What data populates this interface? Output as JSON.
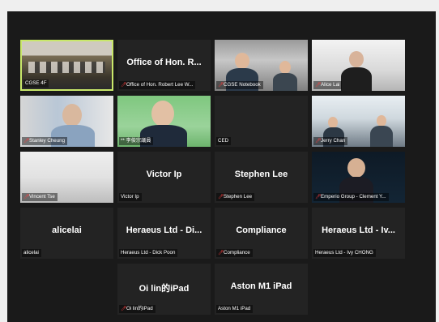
{
  "tiles": [
    {
      "label": "CGSE 4F",
      "center_name": "",
      "muted": false,
      "active": true
    },
    {
      "label": "Office of Hon. Robert Lee W...",
      "center_name": "Office of Hon. R...",
      "muted": true
    },
    {
      "label": "CGSE Notebook",
      "center_name": "",
      "muted": true
    },
    {
      "label": "Alice Lai",
      "center_name": "",
      "muted": true
    },
    {
      "label": "Stanley Cheung",
      "center_name": "",
      "muted": true
    },
    {
      "label": "** 李俊宗議員",
      "center_name": "",
      "muted": false
    },
    {
      "label": "CED",
      "center_name": "",
      "muted": false
    },
    {
      "label": "Jerry Chan",
      "center_name": "",
      "muted": true
    },
    {
      "label": "Vincent Tse",
      "center_name": "",
      "muted": true
    },
    {
      "label": "Victor Ip",
      "center_name": "Victor Ip",
      "muted": false
    },
    {
      "label": "Stephen Lee",
      "center_name": "Stephen Lee",
      "muted": true
    },
    {
      "label": "Emperio Group - Clement Y...",
      "center_name": "",
      "muted": true
    },
    {
      "label": "alicelai",
      "center_name": "alicelai",
      "muted": false
    },
    {
      "label": "Heraeus Ltd - Dick Poon",
      "center_name": "Heraeus Ltd - Di...",
      "muted": false
    },
    {
      "label": "Compliance",
      "center_name": "Compliance",
      "muted": true
    },
    {
      "label": "Heraeus Ltd - Ivy CHONG",
      "center_name": "Heraeus Ltd - Iv...",
      "muted": false
    },
    {
      "label": "Oi lin的iPad",
      "center_name": "Oi lin的iPad",
      "muted": true
    },
    {
      "label": "Aston M1 iPad",
      "center_name": "Aston M1 iPad",
      "muted": false
    }
  ],
  "icons": {
    "muted": "mic-muted-icon"
  }
}
